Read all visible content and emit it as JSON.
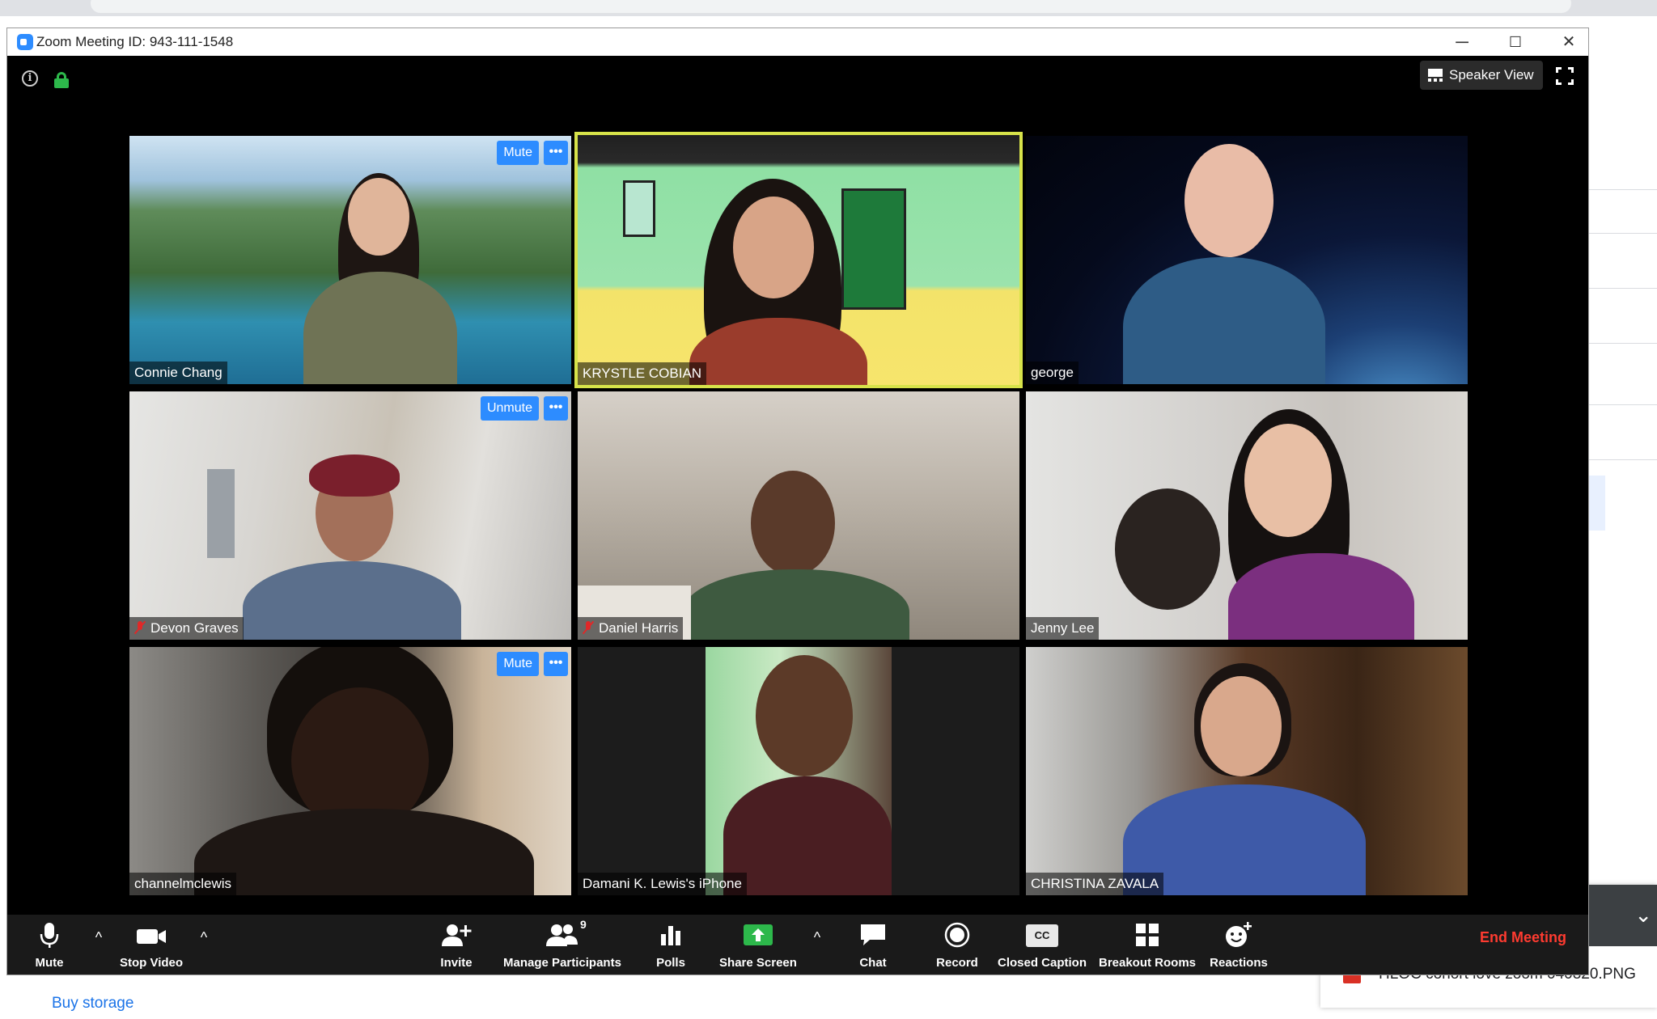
{
  "window": {
    "title": "Zoom Meeting ID: 943-111-1548",
    "minimize": "─",
    "maximize": "☐",
    "close": "✕"
  },
  "top_controls": {
    "info": "i",
    "view_label": "Speaker View"
  },
  "participants": [
    {
      "name": "Connie Chang",
      "button": "Mute",
      "muted": false
    },
    {
      "name": "KRYSTLE COBIAN",
      "button": "",
      "muted": false,
      "active_speaker": true
    },
    {
      "name": "george",
      "button": "",
      "muted": false
    },
    {
      "name": "Devon Graves",
      "button": "Unmute",
      "muted": true
    },
    {
      "name": "Daniel Harris",
      "button": "",
      "muted": true
    },
    {
      "name": "Jenny Lee",
      "button": "",
      "muted": false
    },
    {
      "name": "channelmclewis",
      "button": "Mute",
      "muted": false
    },
    {
      "name": "Damani K. Lewis's iPhone",
      "button": "",
      "muted": false
    },
    {
      "name": "CHRISTINA ZAVALA",
      "button": "",
      "muted": false
    }
  ],
  "more_label": "•••",
  "toolbar": {
    "mute": "Mute",
    "stop_video": "Stop Video",
    "invite": "Invite",
    "manage_participants": "Manage Participants",
    "participant_count": "9",
    "polls": "Polls",
    "share_screen": "Share Screen",
    "chat": "Chat",
    "record": "Record",
    "closed_caption": "Closed Caption",
    "cc_badge": "CC",
    "breakout_rooms": "Breakout Rooms",
    "reactions": "Reactions",
    "end_meeting": "End Meeting",
    "caret": "^"
  },
  "browser": {
    "buy_storage": "Buy storage",
    "download_file": "HLOC cohort love zoom 040820.PNG"
  },
  "colors": {
    "zoom_blue": "#2d8cff",
    "active_speaker_border": "#d7e34a",
    "end_meeting_red": "#ff3b30",
    "share_green": "#2db84b"
  }
}
